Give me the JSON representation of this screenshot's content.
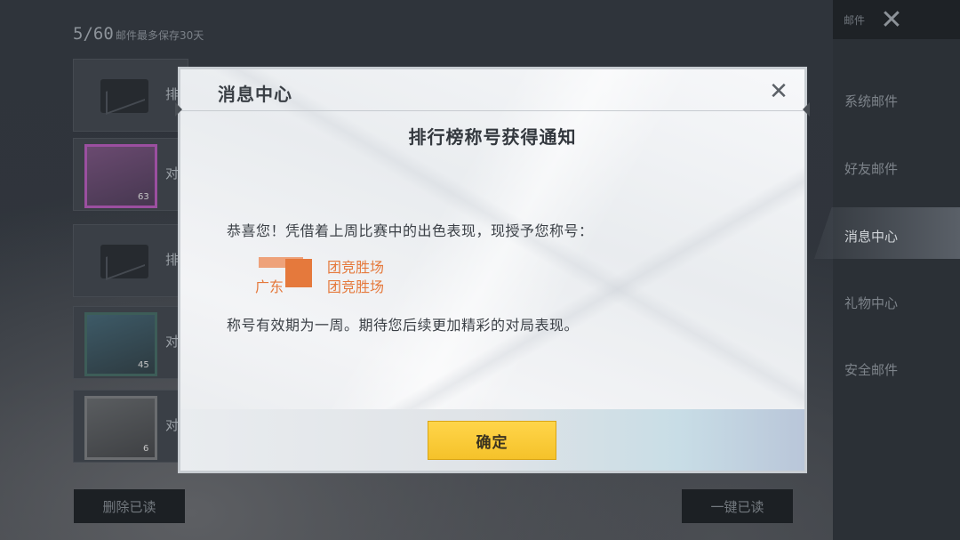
{
  "background": {
    "mail_count": "5/60",
    "mail_hint": "邮件最多保存30天",
    "mail_rows": [
      {
        "type": "envelope",
        "label": "排"
      },
      {
        "type": "thumb",
        "style": "purple",
        "label": "对",
        "level": "63"
      },
      {
        "type": "envelope",
        "label": "排"
      },
      {
        "type": "thumb",
        "style": "teal",
        "label": "对",
        "level": "45"
      },
      {
        "type": "thumb",
        "style": "gray",
        "label": "对",
        "level": "6"
      }
    ],
    "top_tag": "邮件",
    "sidebar": {
      "items": [
        "系统邮件",
        "好友邮件",
        "消息中心",
        "礼物中心",
        "安全邮件"
      ],
      "active": "消息中心"
    },
    "delete_read_label": "删除已读",
    "mark_all_read_label": "一键已读"
  },
  "modal": {
    "title": "消息中心",
    "notice_title": "排行榜称号获得通知",
    "greeting": "恭喜您！凭借着上周比赛中的出色表现，现授予您称号：",
    "titles": [
      "团竞胜场",
      "团竞胜场"
    ],
    "title_prefix": "广东",
    "closing": "称号有效期为一周。期待您后续更加精彩的对局表现。",
    "confirm_label": "确定"
  },
  "colors": {
    "accent_orange": "#e5793c",
    "confirm_yellow": "#f5c22a",
    "panel_bg": "#2b3036"
  }
}
